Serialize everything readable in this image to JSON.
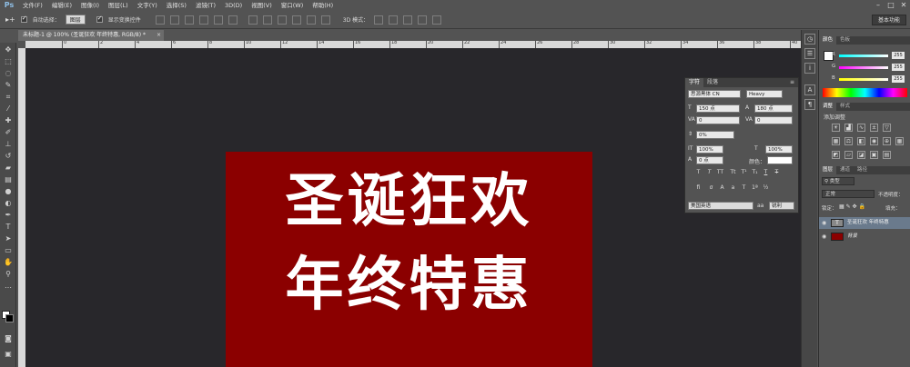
{
  "menubar": {
    "logo": "Ps",
    "items": [
      "文件(F)",
      "编辑(E)",
      "图像(I)",
      "图层(L)",
      "文字(Y)",
      "选择(S)",
      "滤镜(T)",
      "3D(D)",
      "视图(V)",
      "窗口(W)",
      "帮助(H)"
    ]
  },
  "options": {
    "auto_select_label": "自动选择：",
    "auto_select_value": "图层",
    "show_transform_label": "显示变换控件",
    "mode_3d_label": "3D 模式：",
    "workspace": "基本功能"
  },
  "document": {
    "tab_title": "未标题-1 @ 100% (圣诞狂欢 年终特惠, RGB/8) *",
    "ruler_ticks": [
      "0",
      "2",
      "4",
      "6",
      "8",
      "10",
      "12",
      "14",
      "16",
      "18",
      "20",
      "22",
      "24",
      "26",
      "28",
      "30",
      "32",
      "34",
      "36",
      "38",
      "40"
    ]
  },
  "artwork": {
    "line1": "圣诞狂欢",
    "line2": "年终特惠",
    "background_color": "#8b0000",
    "text_color": "#ffffff"
  },
  "character_panel": {
    "tabs": [
      "字符",
      "段落"
    ],
    "font_family": "思源黑体 CN",
    "font_style": "Heavy",
    "font_size": "150 点",
    "leading": "180 点",
    "kerning": "0",
    "tracking": "0",
    "scale_percent": "0%",
    "vertical_scale": "100%",
    "horizontal_scale": "100%",
    "baseline_shift": "0 点",
    "color_label": "颜色：",
    "language": "美国英语",
    "antialias": "锐利"
  },
  "color_panel": {
    "tabs": [
      "颜色",
      "色板"
    ],
    "r_label": "R",
    "g_label": "G",
    "b_label": "B",
    "r_value": "255",
    "g_value": "255",
    "b_value": "255"
  },
  "adjustments_panel": {
    "tabs": [
      "调整",
      "样式"
    ],
    "add_label": "添加调整"
  },
  "layers_panel": {
    "tabs": [
      "图层",
      "通道",
      "路径"
    ],
    "kind_filter": "类型",
    "blend_mode": "正常",
    "opacity_label": "不透明度：",
    "lock_label": "锁定：",
    "fill_label": "填充：",
    "layers": [
      {
        "name": "圣诞狂欢 年终特惠",
        "type": "text"
      },
      {
        "name": "背景",
        "type": "image",
        "thumb_color": "#8b0000"
      }
    ]
  }
}
